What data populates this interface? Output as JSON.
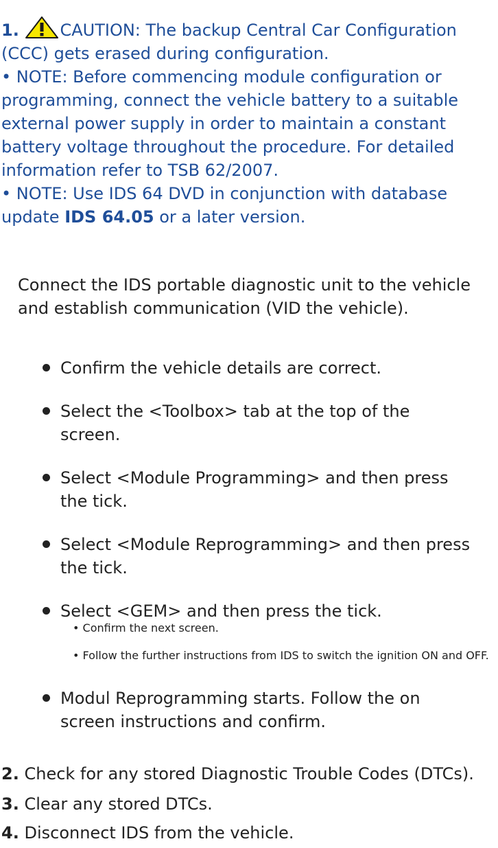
{
  "step1": {
    "number": "1.",
    "caution": "CAUTION: The backup Central Car Configuration (CCC) gets erased during configuration.",
    "note1": "• NOTE: Before commencing module configuration or programming, connect the vehicle battery to a suitable external power supply in order to maintain a constant battery voltage throughout the procedure. For detailed information refer to TSB 62/2007.",
    "note2_prefix": "• NOTE: Use IDS 64 DVD in conjunction with database update ",
    "note2_bold": "IDS 64.05",
    "note2_suffix": " or a later version.",
    "intro": "Connect the IDS portable diagnostic unit to the vehicle and establish communication (VID the vehicle).",
    "bullets": [
      "Confirm the vehicle details are correct.",
      "Select the <Toolbox> tab at the top of the screen.",
      "Select <Module Programming> and then press the tick.",
      "Select <Module Reprogramming> and then press the tick.",
      "Select <GEM> and then press the tick.",
      "Modul Reprogramming starts. Follow the on screen instructions and confirm."
    ],
    "sub_bullets": [
      "• Confirm the next screen.",
      "• Follow the further instructions from IDS to switch the ignition ON and OFF."
    ]
  },
  "steps": [
    {
      "number": "2.",
      "text": "Check for any stored Diagnostic Trouble Codes (DTCs)."
    },
    {
      "number": "3.",
      "text": "Clear any stored DTCs."
    },
    {
      "number": "4.",
      "text": "Disconnect IDS from the vehicle."
    }
  ],
  "colors": {
    "link_blue": "#1f4e99",
    "text": "#222222",
    "warning_yellow": "#f5e600"
  },
  "icons": {
    "warning": "warning-triangle-icon"
  }
}
